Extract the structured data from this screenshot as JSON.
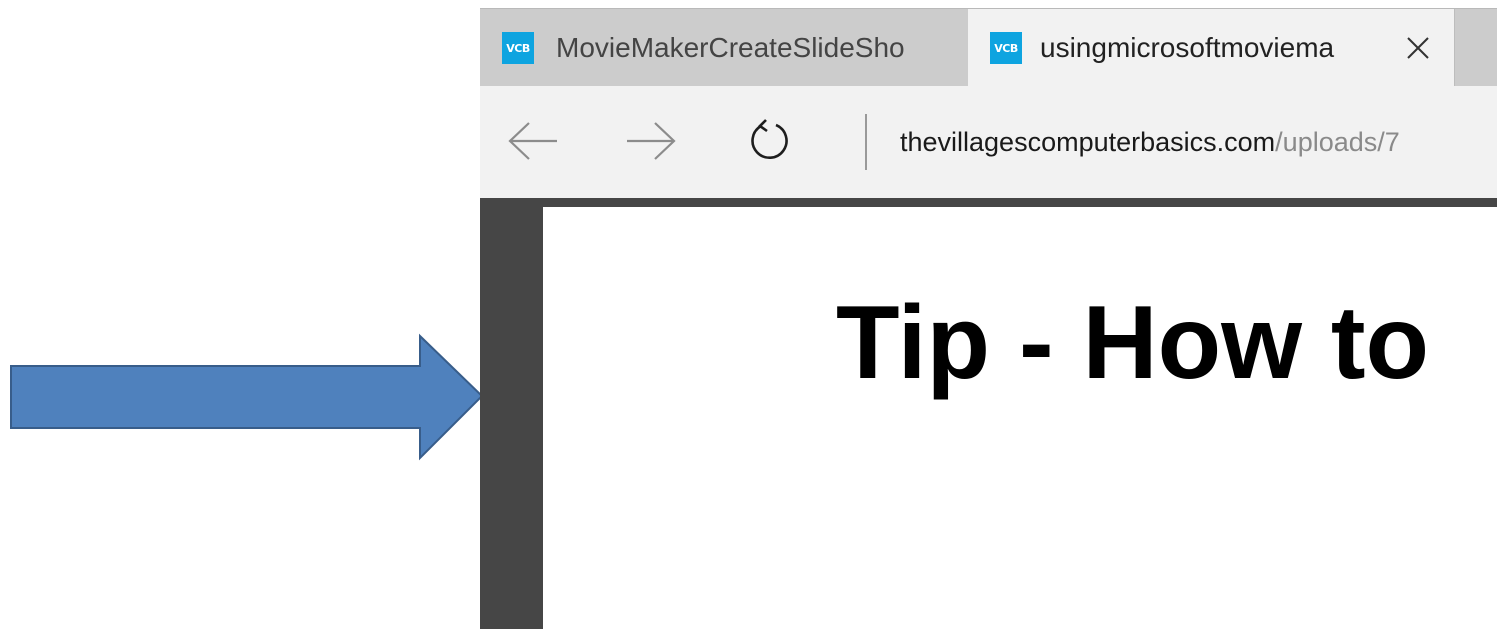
{
  "tabs": [
    {
      "label": "MovieMakerCreateSlideSho",
      "favicon": "VCB",
      "active": false
    },
    {
      "label": "usingmicrosoftmoviema",
      "favicon": "VCB",
      "active": true
    }
  ],
  "icons": {
    "tab_close": "close-icon",
    "back": "arrow-left-icon",
    "forward": "arrow-right-icon",
    "refresh": "refresh-icon",
    "pointer": "arrow-right-icon"
  },
  "address": {
    "domain": "thevillagescomputerbasics.com",
    "path": "/uploads/7"
  },
  "document": {
    "title": "Tip - How to"
  },
  "colors": {
    "favicon_bg": "#0ea4e0",
    "arrow_fill": "#4f81bd",
    "arrow_stroke": "#385d8a",
    "viewer_bg": "#464646",
    "tabstrip_bg": "#cccccc",
    "active_tab_bg": "#f2f2f2"
  }
}
